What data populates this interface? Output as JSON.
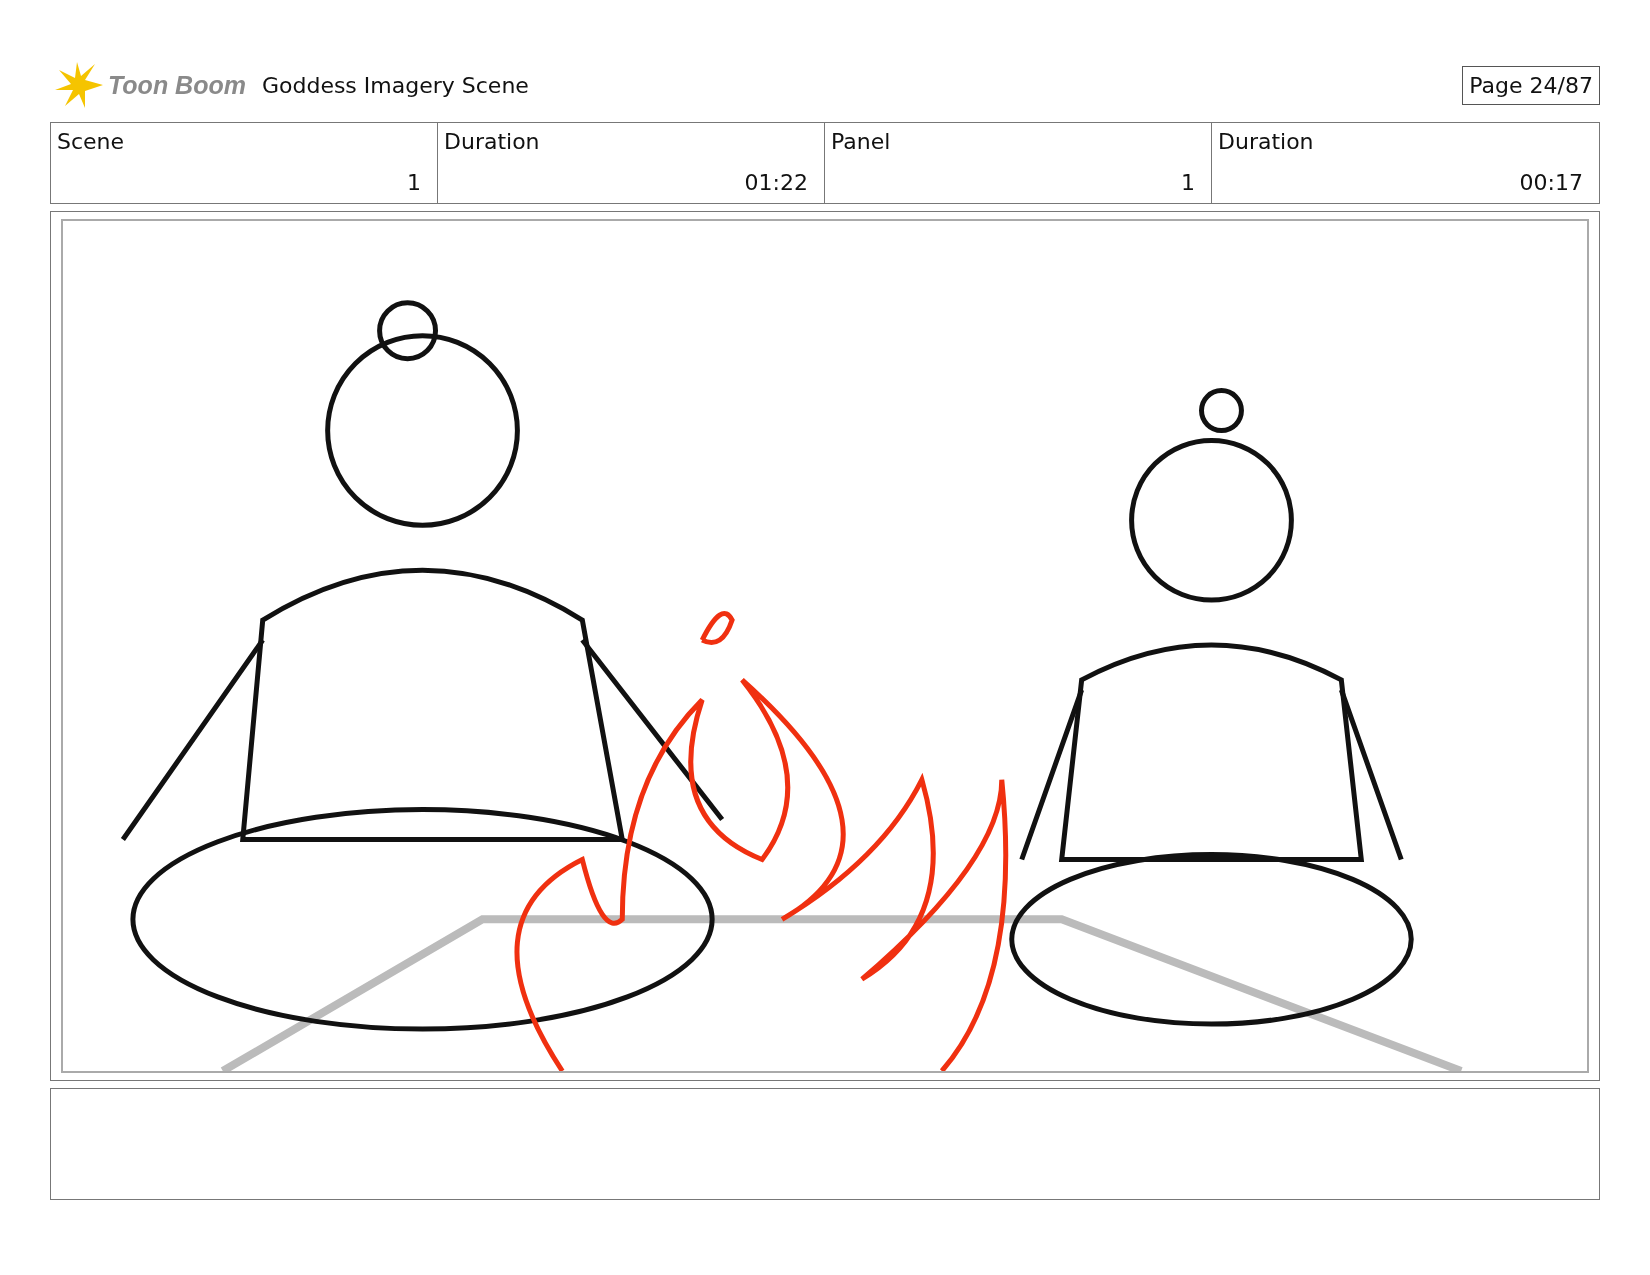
{
  "header": {
    "logo_text": "Toon Boom",
    "title": "Goddess Imagery Scene",
    "page": "Page 24/87"
  },
  "info": [
    {
      "label": "Scene",
      "value": "1"
    },
    {
      "label": "Duration",
      "value": "01:22"
    },
    {
      "label": "Panel",
      "value": "1"
    },
    {
      "label": "Duration",
      "value": "00:17"
    }
  ]
}
